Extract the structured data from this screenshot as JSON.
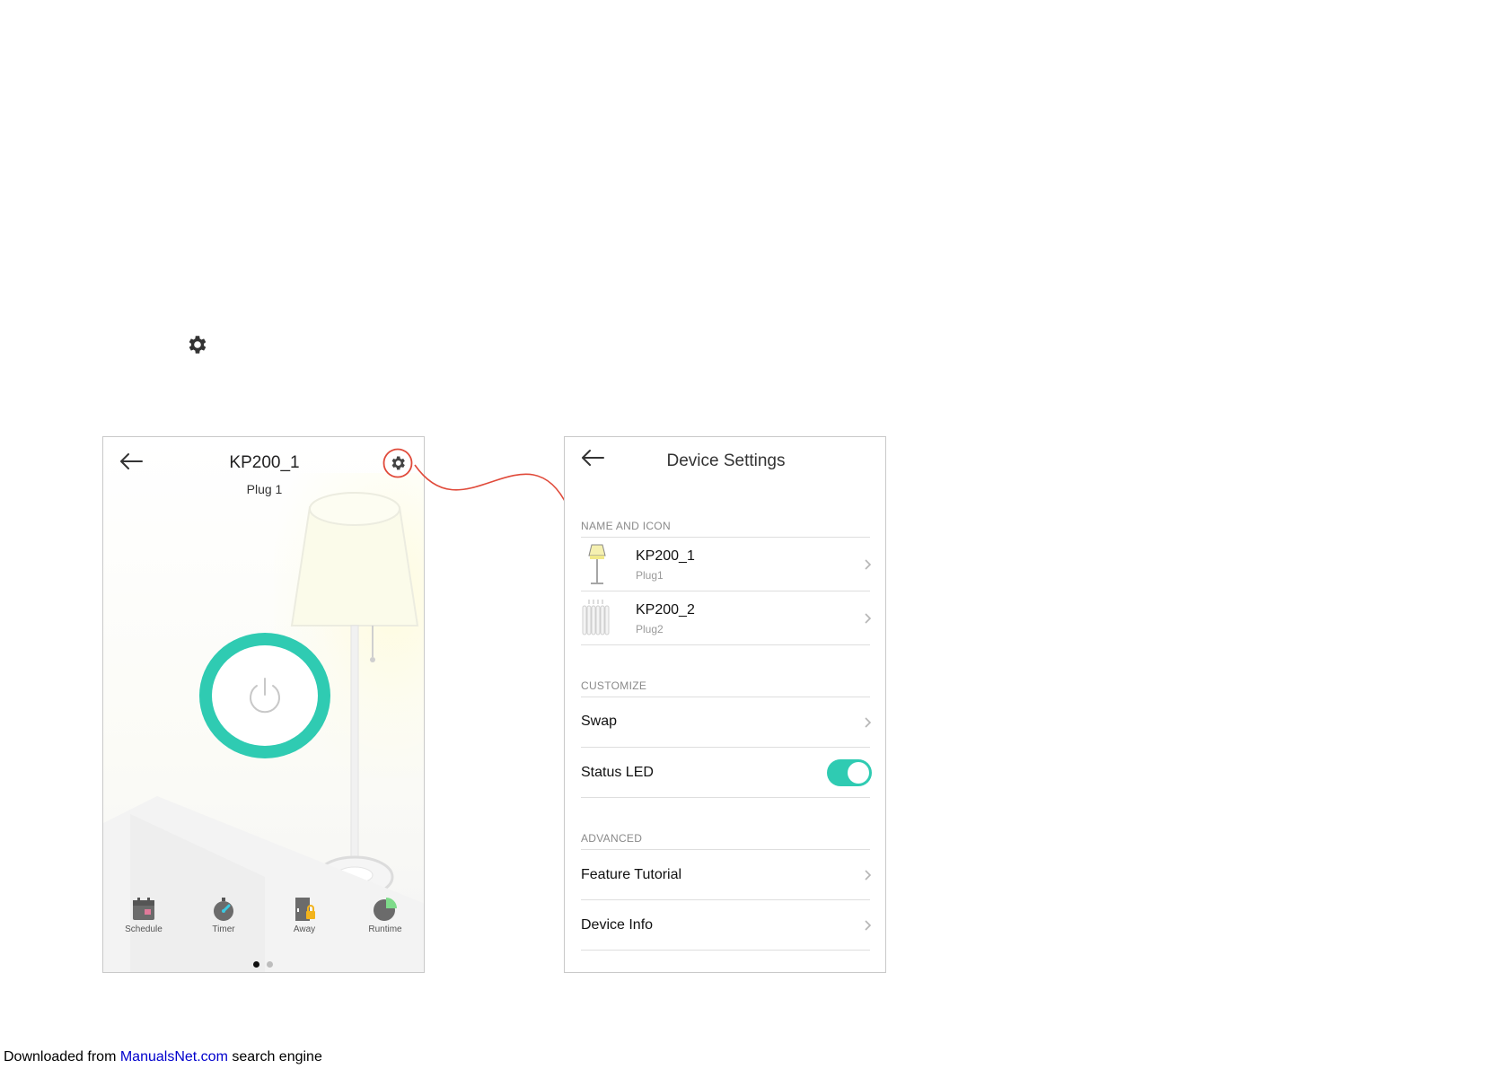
{
  "phone1": {
    "title": "KP200_1",
    "subtitle": "Plug 1",
    "features": [
      {
        "label": "Schedule",
        "icon": "calendar-icon"
      },
      {
        "label": "Timer",
        "icon": "stopwatch-icon"
      },
      {
        "label": "Away",
        "icon": "away-lock-icon"
      },
      {
        "label": "Runtime",
        "icon": "runtime-pie-icon"
      }
    ],
    "page_indicator": {
      "pages": 2,
      "active": 1
    }
  },
  "phone2": {
    "title": "Device Settings",
    "sections": {
      "name_and_icon": "NAME AND ICON",
      "customize": "CUSTOMIZE",
      "advanced": "ADVANCED"
    },
    "devices": [
      {
        "name": "KP200_1",
        "sub": "Plug1",
        "icon": "floor-lamp-icon"
      },
      {
        "name": "KP200_2",
        "sub": "Plug2",
        "icon": "radiator-icon"
      }
    ],
    "customize": {
      "swap": "Swap",
      "status_led": "Status LED",
      "status_led_on": true
    },
    "advanced": {
      "feature_tutorial": "Feature Tutorial",
      "device_info": "Device Info"
    }
  },
  "footer": {
    "prefix": "Downloaded from ",
    "link": "ManualsNet.com",
    "suffix": " search engine"
  },
  "colors": {
    "accent": "#2fcbb2",
    "callout": "#e04a3a",
    "link": "#0000cc"
  }
}
